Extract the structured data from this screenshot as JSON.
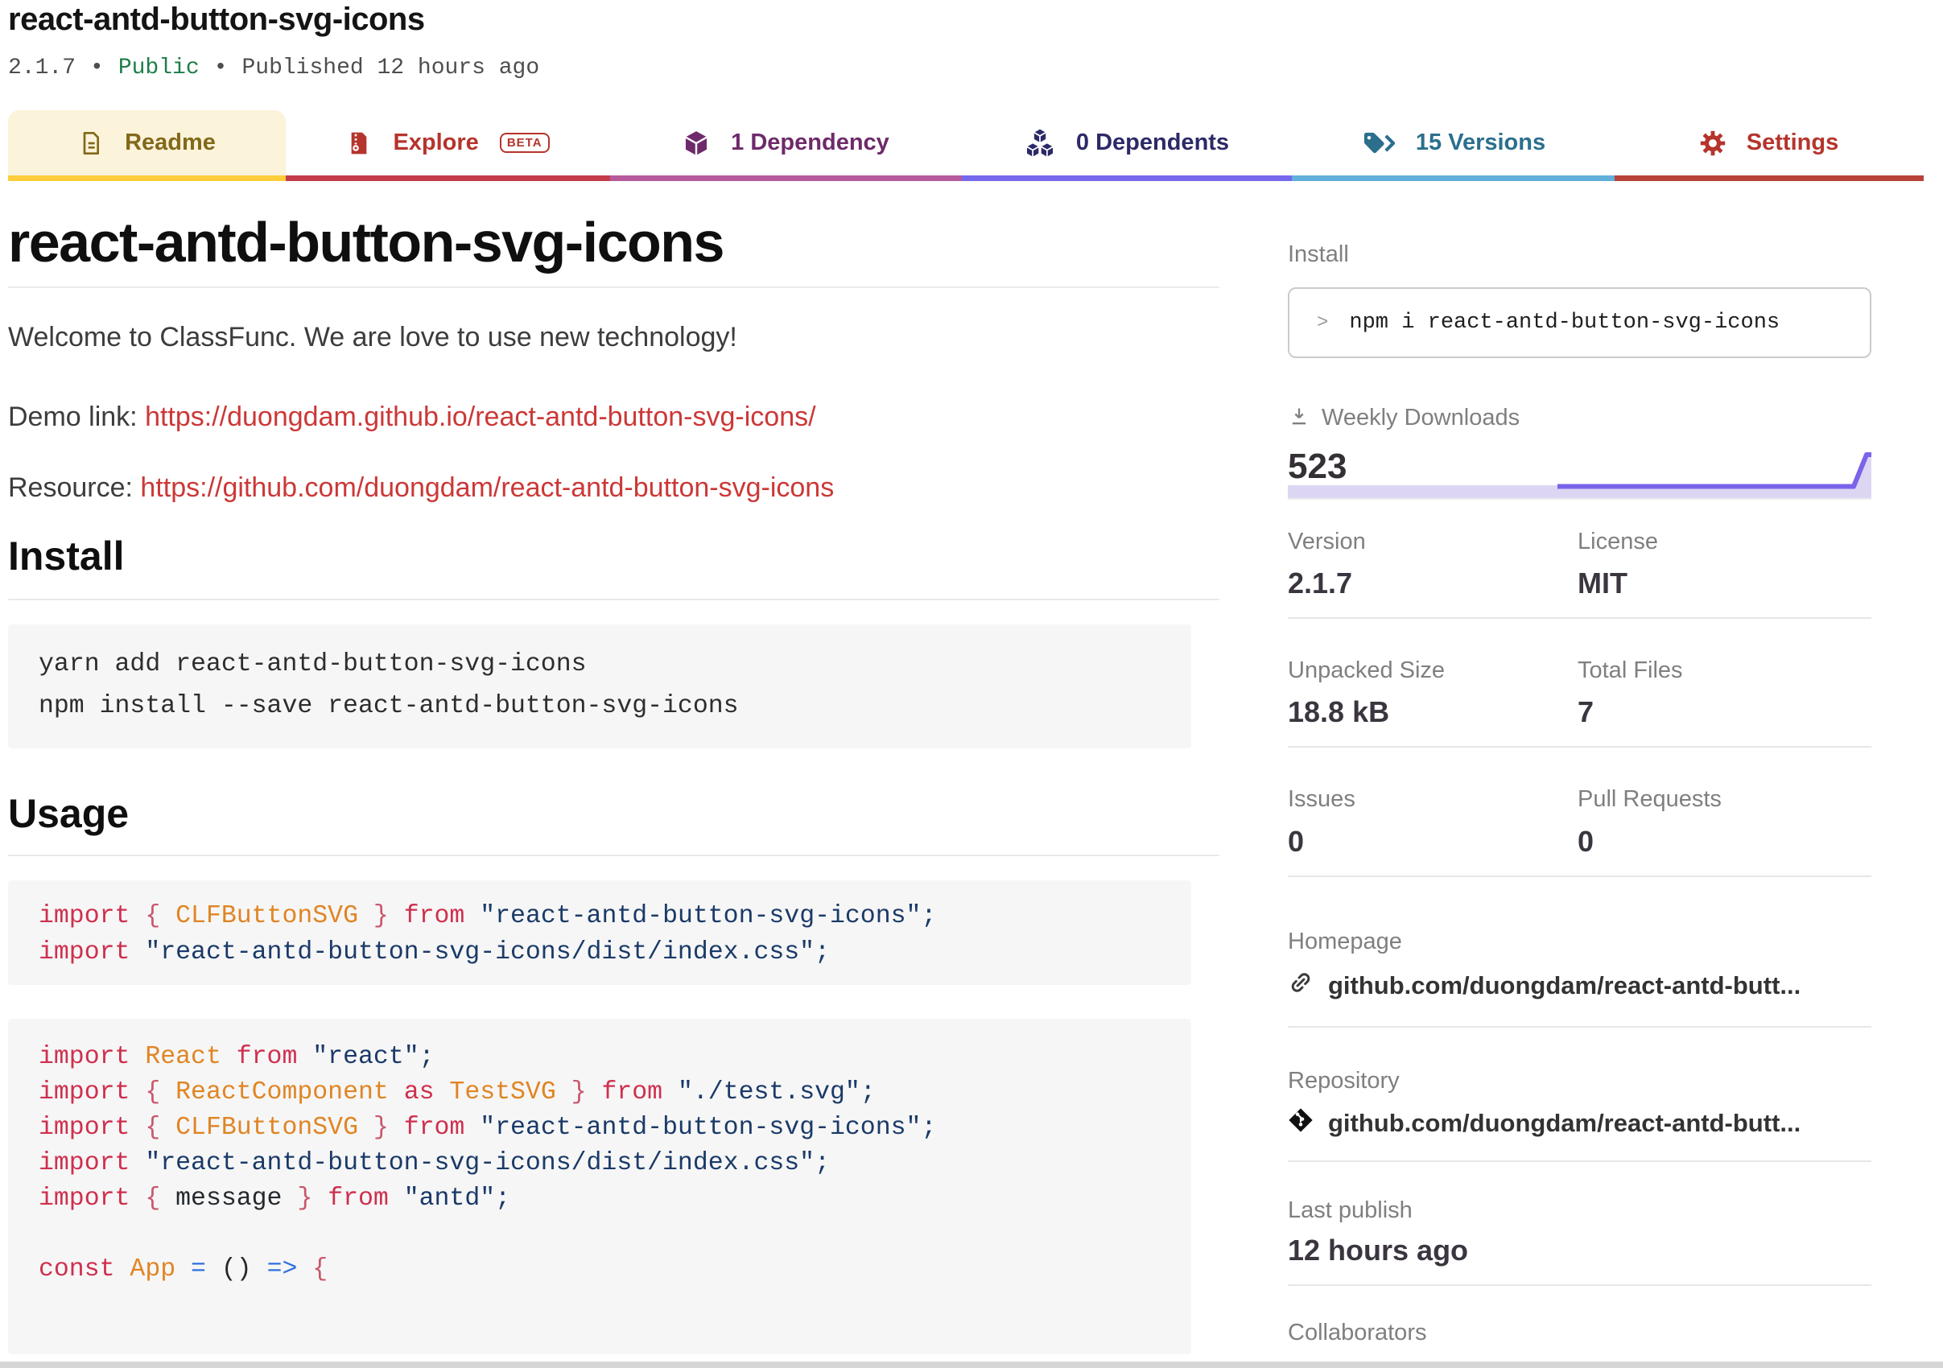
{
  "header": {
    "title": "react-antd-button-svg-icons",
    "version": "2.1.7",
    "separator": "•",
    "visibility": "Public",
    "published": "Published 12 hours ago"
  },
  "tabs": [
    {
      "id": "readme",
      "label": "Readme",
      "icon": "file-icon"
    },
    {
      "id": "explore",
      "label": "Explore",
      "badge": "BETA",
      "icon": "zip-icon"
    },
    {
      "id": "dependency",
      "label": "1 Dependency",
      "icon": "cube-icon"
    },
    {
      "id": "dependents",
      "label": "0 Dependents",
      "icon": "cubes-icon"
    },
    {
      "id": "versions",
      "label": "15 Versions",
      "icon": "tag-icon"
    },
    {
      "id": "settings",
      "label": "Settings",
      "icon": "gear-icon"
    }
  ],
  "readme": {
    "title": "react-antd-button-svg-icons",
    "welcome": "Welcome to ClassFunc. We are love to use new technology!",
    "demo_prefix": "Demo link: ",
    "demo_link": "https://duongdam.github.io/react-antd-button-svg-icons/",
    "resource_prefix": "Resource: ",
    "resource_link": "https://github.com/duongdam/react-antd-button-svg-icons",
    "install_heading": "Install",
    "install_code": [
      "yarn add react-antd-button-svg-icons",
      "npm install --save react-antd-button-svg-icons"
    ],
    "usage_heading": "Usage",
    "usage_code_1": [
      [
        [
          "kw",
          "import"
        ],
        [
          "pl",
          " "
        ],
        [
          "pu",
          "{"
        ],
        [
          "pl",
          " "
        ],
        [
          "id",
          "CLFButtonSVG"
        ],
        [
          "pl",
          " "
        ],
        [
          "pu",
          "}"
        ],
        [
          "pl",
          " "
        ],
        [
          "kw",
          "from"
        ],
        [
          "pl",
          " "
        ],
        [
          "st",
          "\"react-antd-button-svg-icons\""
        ],
        [
          "st",
          ";"
        ]
      ],
      [
        [
          "kw",
          "import"
        ],
        [
          "pl",
          " "
        ],
        [
          "st",
          "\"react-antd-button-svg-icons/dist/index.css\""
        ],
        [
          "st",
          ";"
        ]
      ]
    ],
    "usage_code_2": [
      [
        [
          "kw",
          "import"
        ],
        [
          "pl",
          " "
        ],
        [
          "id",
          "React"
        ],
        [
          "pl",
          " "
        ],
        [
          "kw",
          "from"
        ],
        [
          "pl",
          " "
        ],
        [
          "st",
          "\"react\""
        ],
        [
          "st",
          ";"
        ]
      ],
      [
        [
          "kw",
          "import"
        ],
        [
          "pl",
          " "
        ],
        [
          "pu",
          "{"
        ],
        [
          "pl",
          " "
        ],
        [
          "id",
          "ReactComponent"
        ],
        [
          "pl",
          " "
        ],
        [
          "kw",
          "as"
        ],
        [
          "pl",
          " "
        ],
        [
          "id",
          "TestSVG"
        ],
        [
          "pl",
          " "
        ],
        [
          "pu",
          "}"
        ],
        [
          "pl",
          " "
        ],
        [
          "kw",
          "from"
        ],
        [
          "pl",
          " "
        ],
        [
          "st",
          "\"./test.svg\""
        ],
        [
          "st",
          ";"
        ]
      ],
      [
        [
          "kw",
          "import"
        ],
        [
          "pl",
          " "
        ],
        [
          "pu",
          "{"
        ],
        [
          "pl",
          " "
        ],
        [
          "id",
          "CLFButtonSVG"
        ],
        [
          "pl",
          " "
        ],
        [
          "pu",
          "}"
        ],
        [
          "pl",
          " "
        ],
        [
          "kw",
          "from"
        ],
        [
          "pl",
          " "
        ],
        [
          "st",
          "\"react-antd-button-svg-icons\""
        ],
        [
          "st",
          ";"
        ]
      ],
      [
        [
          "kw",
          "import"
        ],
        [
          "pl",
          " "
        ],
        [
          "st",
          "\"react-antd-button-svg-icons/dist/index.css\""
        ],
        [
          "st",
          ";"
        ]
      ],
      [
        [
          "kw",
          "import"
        ],
        [
          "pl",
          " "
        ],
        [
          "pu",
          "{"
        ],
        [
          "pl",
          " "
        ],
        [
          "tx",
          "message"
        ],
        [
          "pl",
          " "
        ],
        [
          "pu",
          "}"
        ],
        [
          "pl",
          " "
        ],
        [
          "kw",
          "from"
        ],
        [
          "pl",
          " "
        ],
        [
          "st",
          "\"antd\""
        ],
        [
          "st",
          ";"
        ]
      ],
      [],
      [
        [
          "kw",
          "const"
        ],
        [
          "pl",
          " "
        ],
        [
          "id",
          "App"
        ],
        [
          "pl",
          " "
        ],
        [
          "op",
          "="
        ],
        [
          "pl",
          " "
        ],
        [
          "pr",
          "()"
        ],
        [
          "pl",
          " "
        ],
        [
          "op",
          "=>"
        ],
        [
          "pl",
          " "
        ],
        [
          "pu",
          "{"
        ]
      ]
    ]
  },
  "sidebar": {
    "install_label": "Install",
    "install_prompt": ">",
    "install_command": "npm i react-antd-button-svg-icons",
    "weekly_label": "Weekly Downloads",
    "weekly_value": "523",
    "sparkline_values": [
      0,
      0,
      0,
      0,
      0,
      0,
      0,
      0,
      0,
      0,
      523
    ],
    "stats": [
      [
        {
          "label": "Version",
          "value": "2.1.7"
        },
        {
          "label": "License",
          "value": "MIT"
        }
      ],
      [
        {
          "label": "Unpacked Size",
          "value": "18.8 kB"
        },
        {
          "label": "Total Files",
          "value": "7"
        }
      ],
      [
        {
          "label": "Issues",
          "value": "0"
        },
        {
          "label": "Pull Requests",
          "value": "0"
        }
      ]
    ],
    "homepage_label": "Homepage",
    "homepage_link": "github.com/duongdam/react-antd-butt...",
    "repository_label": "Repository",
    "repository_link": "github.com/duongdam/react-antd-butt...",
    "last_publish_label": "Last publish",
    "last_publish_value": "12 hours ago",
    "collaborators_label": "Collaborators"
  }
}
